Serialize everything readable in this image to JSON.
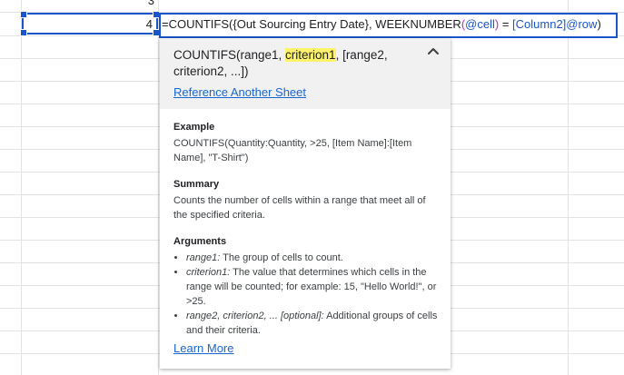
{
  "cells": {
    "prev_row_value": "3",
    "active_value": "4"
  },
  "formula": {
    "part1": "=COUNTIFS(",
    "part2": "{Out Sourcing Entry Date}, WEEKNUMBER",
    "paren_open": "(",
    "ref_cell": "@cell",
    "paren_close": ")",
    "part3": " = ",
    "ref_col": "[Column2]@row",
    "paren_final": ")"
  },
  "help": {
    "signature_pre": "COUNTIFS(range1, ",
    "signature_highlight": "criterion1",
    "signature_post": ", [range2, criterion2, ...])",
    "reference_link": "Reference Another Sheet",
    "example_title": "Example",
    "example_text": "COUNTIFS(Quantity:Quantity, >25, [Item Name]:[Item Name], \"T-Shirt\")",
    "summary_title": "Summary",
    "summary_text": "Counts the number of cells within a range that meet all of the specified criteria.",
    "arguments_title": "Arguments",
    "arguments": [
      {
        "name": "range1:",
        "desc": " The group of cells to count."
      },
      {
        "name": "criterion1:",
        "desc": " The value that determines which cells in the range will be counted; for example: 15, \"Hello World!\", or >25."
      },
      {
        "name": "range2, criterion2, ... [optional]:",
        "desc": " Additional groups of cells and their criteria."
      }
    ],
    "learn_more": "Learn More"
  },
  "icons": {
    "collapse": "chevron-up-icon"
  }
}
